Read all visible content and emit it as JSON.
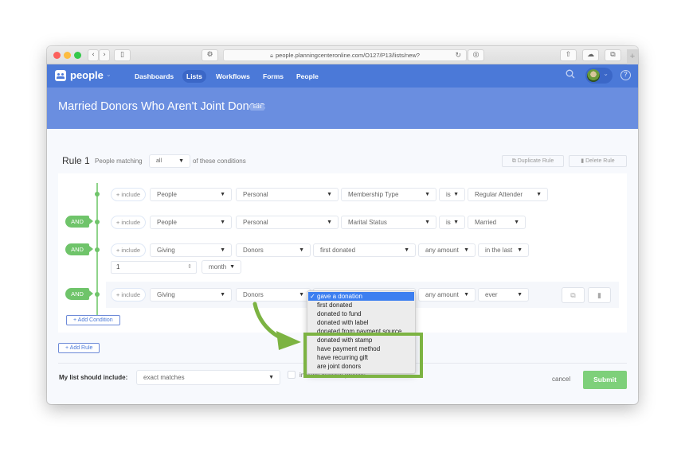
{
  "browser": {
    "url": "people.planningcenteronline.com/O127/P13/lists/new?",
    "buttons": {
      "back": "‹",
      "forward": "›",
      "sidebar": "▯",
      "extension": "⚙",
      "reload": "↻",
      "reader": "◎",
      "share": "⇧",
      "cloud": "☁",
      "tabs": "⧉",
      "new_tab": "+"
    }
  },
  "nav": {
    "app_name": "people",
    "app_chevron": "⌄",
    "items": [
      {
        "label": "Dashboards",
        "active": false
      },
      {
        "label": "Lists",
        "active": true
      },
      {
        "label": "Workflows",
        "active": false
      },
      {
        "label": "Forms",
        "active": false
      },
      {
        "label": "People",
        "active": false
      }
    ],
    "search_icon": "⚲",
    "help_icon": "?",
    "avatar_chevron": "⌄"
  },
  "header": {
    "title": "Married Donors Who Aren't Joint Donors",
    "edit_label": "Edit"
  },
  "rule": {
    "title": "Rule 1",
    "matching_prefix": "People matching",
    "matching_value": "all",
    "matching_suffix": "of these conditions",
    "duplicate_label": "Duplicate Rule",
    "delete_label": "Delete Rule",
    "conditions": [
      {
        "connector": "",
        "include": "+ include",
        "fields": [
          "People",
          "Personal",
          "Membership Type",
          "is",
          "Regular Attender"
        ]
      },
      {
        "connector": "AND",
        "include": "+ include",
        "fields": [
          "People",
          "Personal",
          "Marital Status",
          "is",
          "Married"
        ]
      },
      {
        "connector": "AND",
        "include": "+ include",
        "fields": [
          "Giving",
          "Donors",
          "first donated",
          "any amount",
          "in the last"
        ],
        "number_value": "1",
        "period": "month"
      },
      {
        "connector": "AND",
        "include": "+ include",
        "fields": [
          "Giving",
          "Donors",
          "gave a donation",
          "any amount",
          "ever"
        ]
      }
    ],
    "add_condition_label": "+ Add Condition"
  },
  "dropdown": {
    "selected": "gave a donation",
    "check": "✓",
    "options": [
      "gave a donation",
      "first donated",
      "donated to fund",
      "donated with label",
      "donated from payment source",
      "donated with stamp",
      "have payment method",
      "have recurring gift",
      "are joint donors"
    ],
    "highlighted_options": [
      "donated with stamp",
      "have payment method",
      "have recurring gift",
      "are joint donors"
    ]
  },
  "add_rule_label": "+ Add Rule",
  "footer": {
    "list_include_label": "My list should include:",
    "list_include_value": "exact matches",
    "inactive_label": "include inactive profiles",
    "cancel_label": "cancel",
    "submit_label": "Submit"
  },
  "colors": {
    "nav_blue": "#4b79d8",
    "header_blue": "#6a8ee0",
    "and_green": "#6fc46a",
    "submit_green": "#7ed07a",
    "highlight_green": "#7cb342",
    "menu_selected": "#3d7ff0"
  }
}
